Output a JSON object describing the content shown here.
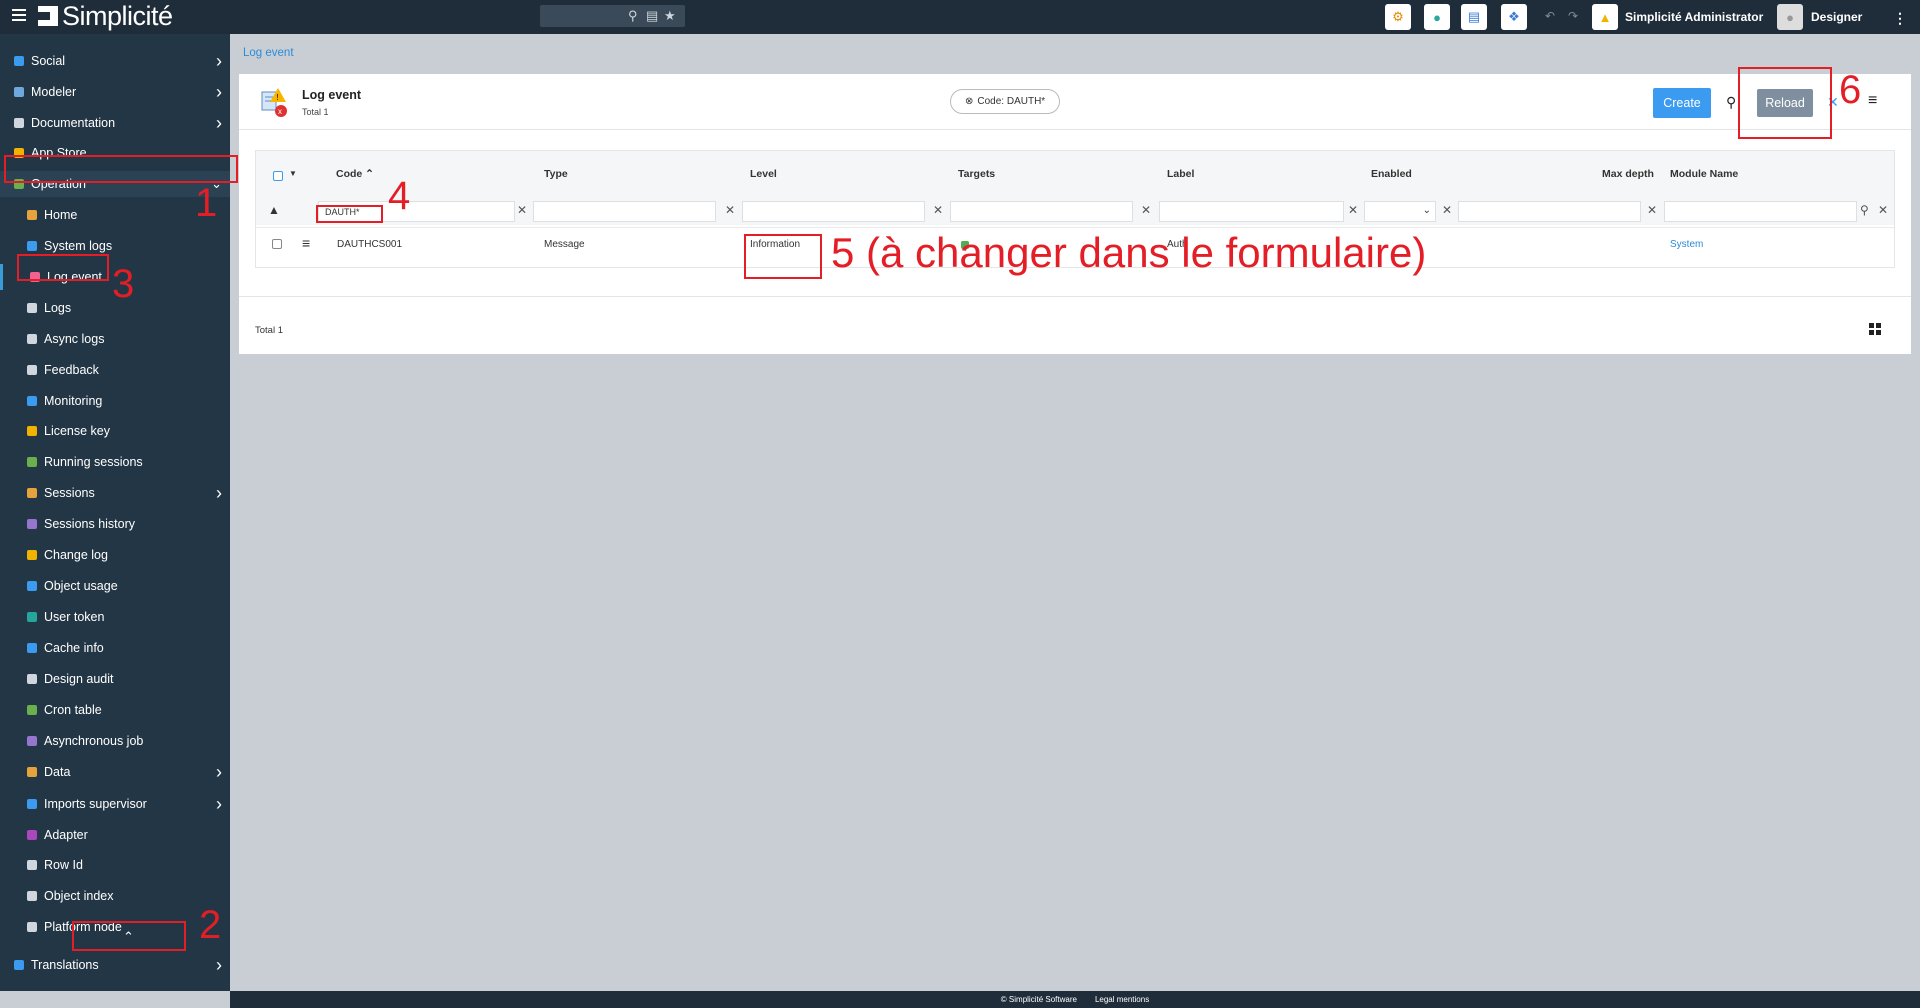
{
  "app": {
    "brand": "Simplicité",
    "user_name": "Simplicité Administrator",
    "scope": "Designer"
  },
  "sidebar": {
    "items": [
      {
        "label": "Social",
        "level": 0,
        "chevron": "right"
      },
      {
        "label": "Modeler",
        "level": 0,
        "chevron": "right"
      },
      {
        "label": "Documentation",
        "level": 0,
        "chevron": "right"
      },
      {
        "label": "App Store",
        "level": 0,
        "chevron": ""
      },
      {
        "label": "Operation",
        "level": 0,
        "chevron": "down"
      },
      {
        "label": "Home",
        "level": 1,
        "chevron": ""
      },
      {
        "label": "System logs",
        "level": 1,
        "chevron": ""
      },
      {
        "label": "Log event",
        "level": 1,
        "chevron": ""
      },
      {
        "label": "Logs",
        "level": 1,
        "chevron": ""
      },
      {
        "label": "Async logs",
        "level": 1,
        "chevron": ""
      },
      {
        "label": "Feedback",
        "level": 1,
        "chevron": ""
      },
      {
        "label": "Monitoring",
        "level": 1,
        "chevron": ""
      },
      {
        "label": "License key",
        "level": 1,
        "chevron": ""
      },
      {
        "label": "Running sessions",
        "level": 1,
        "chevron": ""
      },
      {
        "label": "Sessions",
        "level": 1,
        "chevron": "right"
      },
      {
        "label": "Sessions history",
        "level": 1,
        "chevron": ""
      },
      {
        "label": "Change log",
        "level": 1,
        "chevron": ""
      },
      {
        "label": "Object usage",
        "level": 1,
        "chevron": ""
      },
      {
        "label": "User token",
        "level": 1,
        "chevron": ""
      },
      {
        "label": "Cache info",
        "level": 1,
        "chevron": ""
      },
      {
        "label": "Design audit",
        "level": 1,
        "chevron": ""
      },
      {
        "label": "Cron table",
        "level": 1,
        "chevron": ""
      },
      {
        "label": "Asynchronous job",
        "level": 1,
        "chevron": ""
      },
      {
        "label": "Data",
        "level": 1,
        "chevron": "right"
      },
      {
        "label": "Imports supervisor",
        "level": 1,
        "chevron": "right"
      },
      {
        "label": "Adapter",
        "level": 1,
        "chevron": ""
      },
      {
        "label": "Row Id",
        "level": 1,
        "chevron": ""
      },
      {
        "label": "Object index",
        "level": 1,
        "chevron": ""
      },
      {
        "label": "Platform node",
        "level": 1,
        "chevron": ""
      }
    ],
    "bottom_item": "Translations"
  },
  "breadcrumb": "Log event",
  "panel": {
    "title": "Log event",
    "total": "Total 1",
    "filter_chip": "Code: DAUTH*",
    "create_label": "Create",
    "reload_label": "Reload"
  },
  "grid": {
    "columns": [
      "Code",
      "Type",
      "Level",
      "Targets",
      "Label",
      "Enabled",
      "Max depth",
      "Module Name"
    ],
    "filter_code_value": "DAUTH*",
    "rows": [
      {
        "code": "DAUTHCS001",
        "type": "Message",
        "level": "Information",
        "targets": "",
        "label": "Auth",
        "enabled": "",
        "max_depth": "",
        "module": "System"
      }
    ]
  },
  "footer_total": "Total 1",
  "footer": {
    "copyright": "© Simplicité Software",
    "legal": "Legal mentions"
  },
  "annotations": {
    "n1": "1",
    "n2": "2",
    "n3": "3",
    "n4": "4",
    "n5": "5 (à changer dans le formulaire)",
    "n6": "6",
    "color": "#e41e26"
  }
}
